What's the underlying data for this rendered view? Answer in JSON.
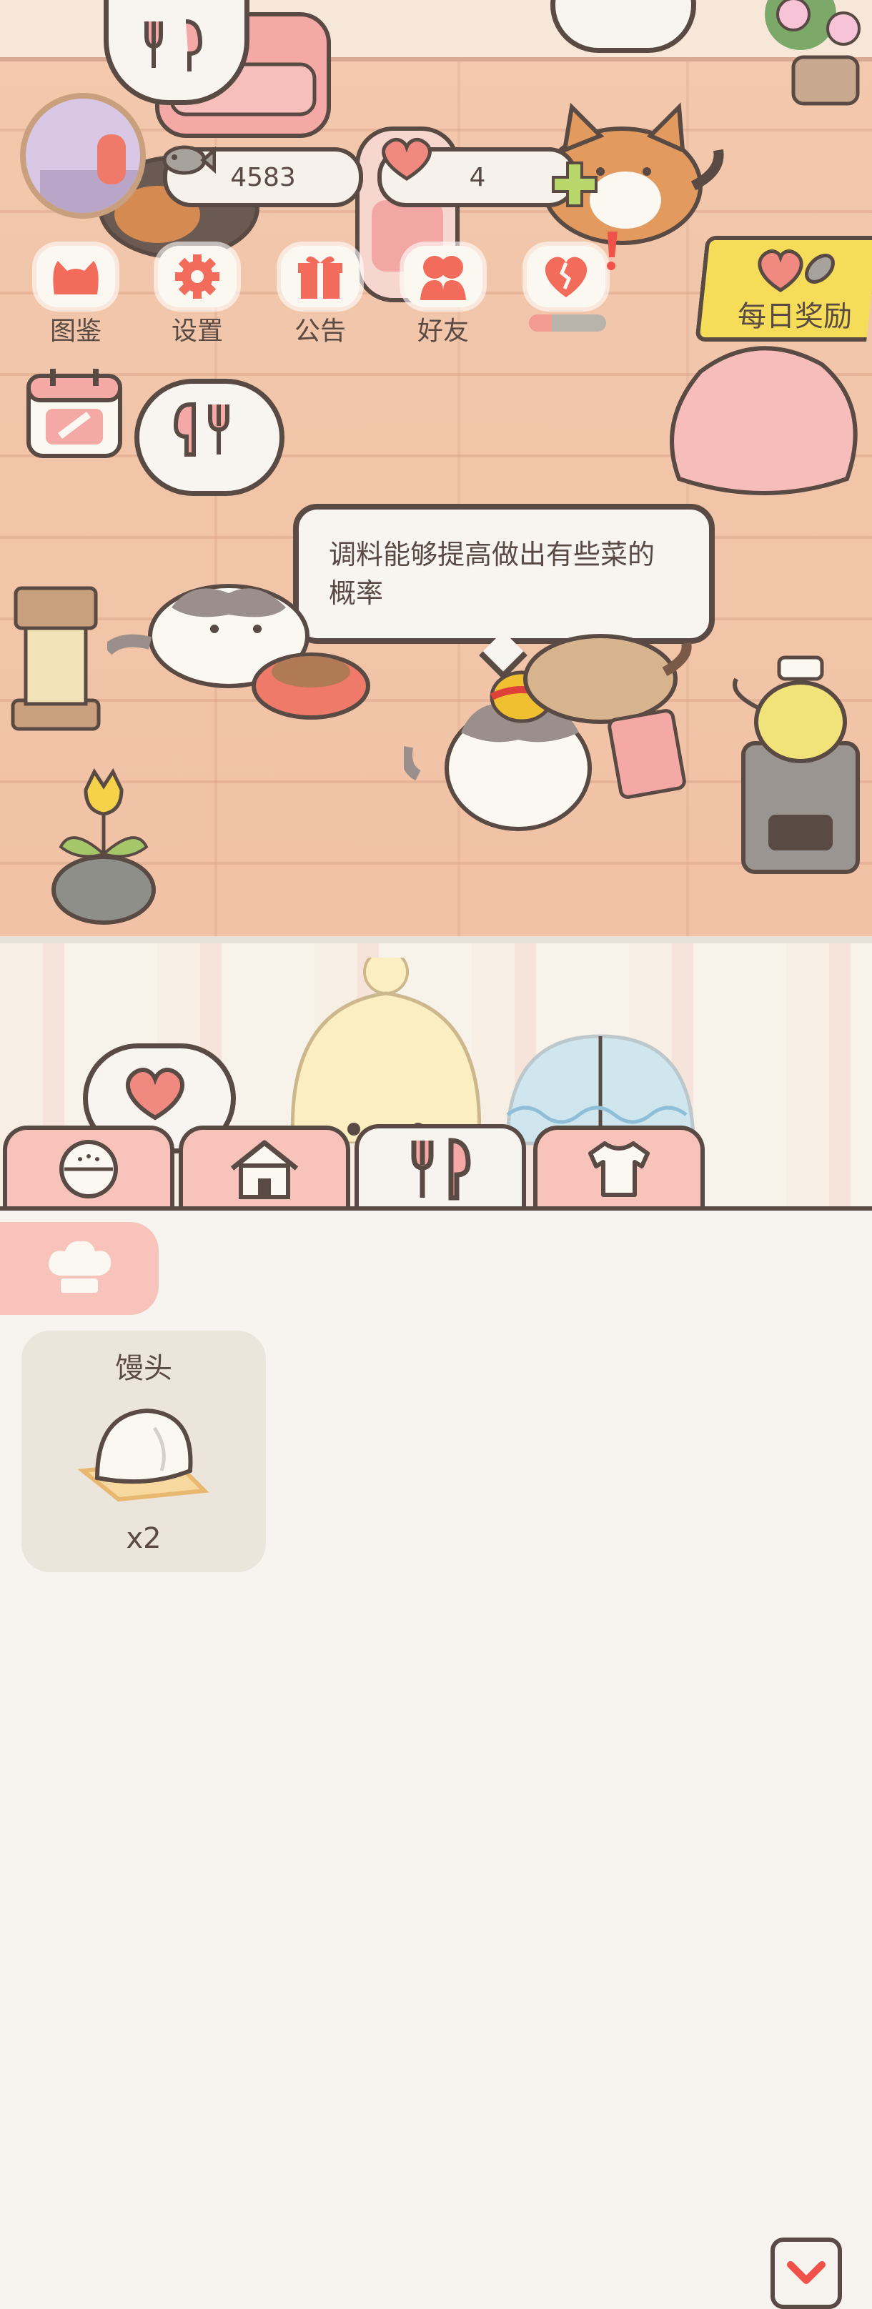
{
  "currency": {
    "fish_count": "4583",
    "heart_count": "4"
  },
  "menu": {
    "items": [
      {
        "label": "图鉴",
        "icon": "cat-face-icon"
      },
      {
        "label": "设置",
        "icon": "gear-icon"
      },
      {
        "label": "公告",
        "icon": "gift-icon"
      },
      {
        "label": "好友",
        "icon": "friends-icon"
      },
      {
        "label": "",
        "icon": "broken-heart-icon"
      }
    ]
  },
  "daily_reward": {
    "label": "每日奖励"
  },
  "tip": {
    "text": "调料能够提高做出有些菜的概率"
  },
  "tabs": [
    {
      "name": "rice-bowl",
      "icon": "rice-bowl-icon"
    },
    {
      "name": "house",
      "icon": "house-icon"
    },
    {
      "name": "cooking",
      "icon": "fork-spoon-icon"
    },
    {
      "name": "clothes",
      "icon": "shirt-icon"
    }
  ],
  "inventory": {
    "items": [
      {
        "name": "馒头",
        "count": "x2"
      }
    ]
  },
  "colors": {
    "outline": "#5a4a44",
    "floor": "#f2c4a8",
    "pink": "#f7c3bb",
    "accent": "#f26b5b",
    "panel": "#f7f3ee",
    "daily_yellow": "#f5dd5a"
  }
}
